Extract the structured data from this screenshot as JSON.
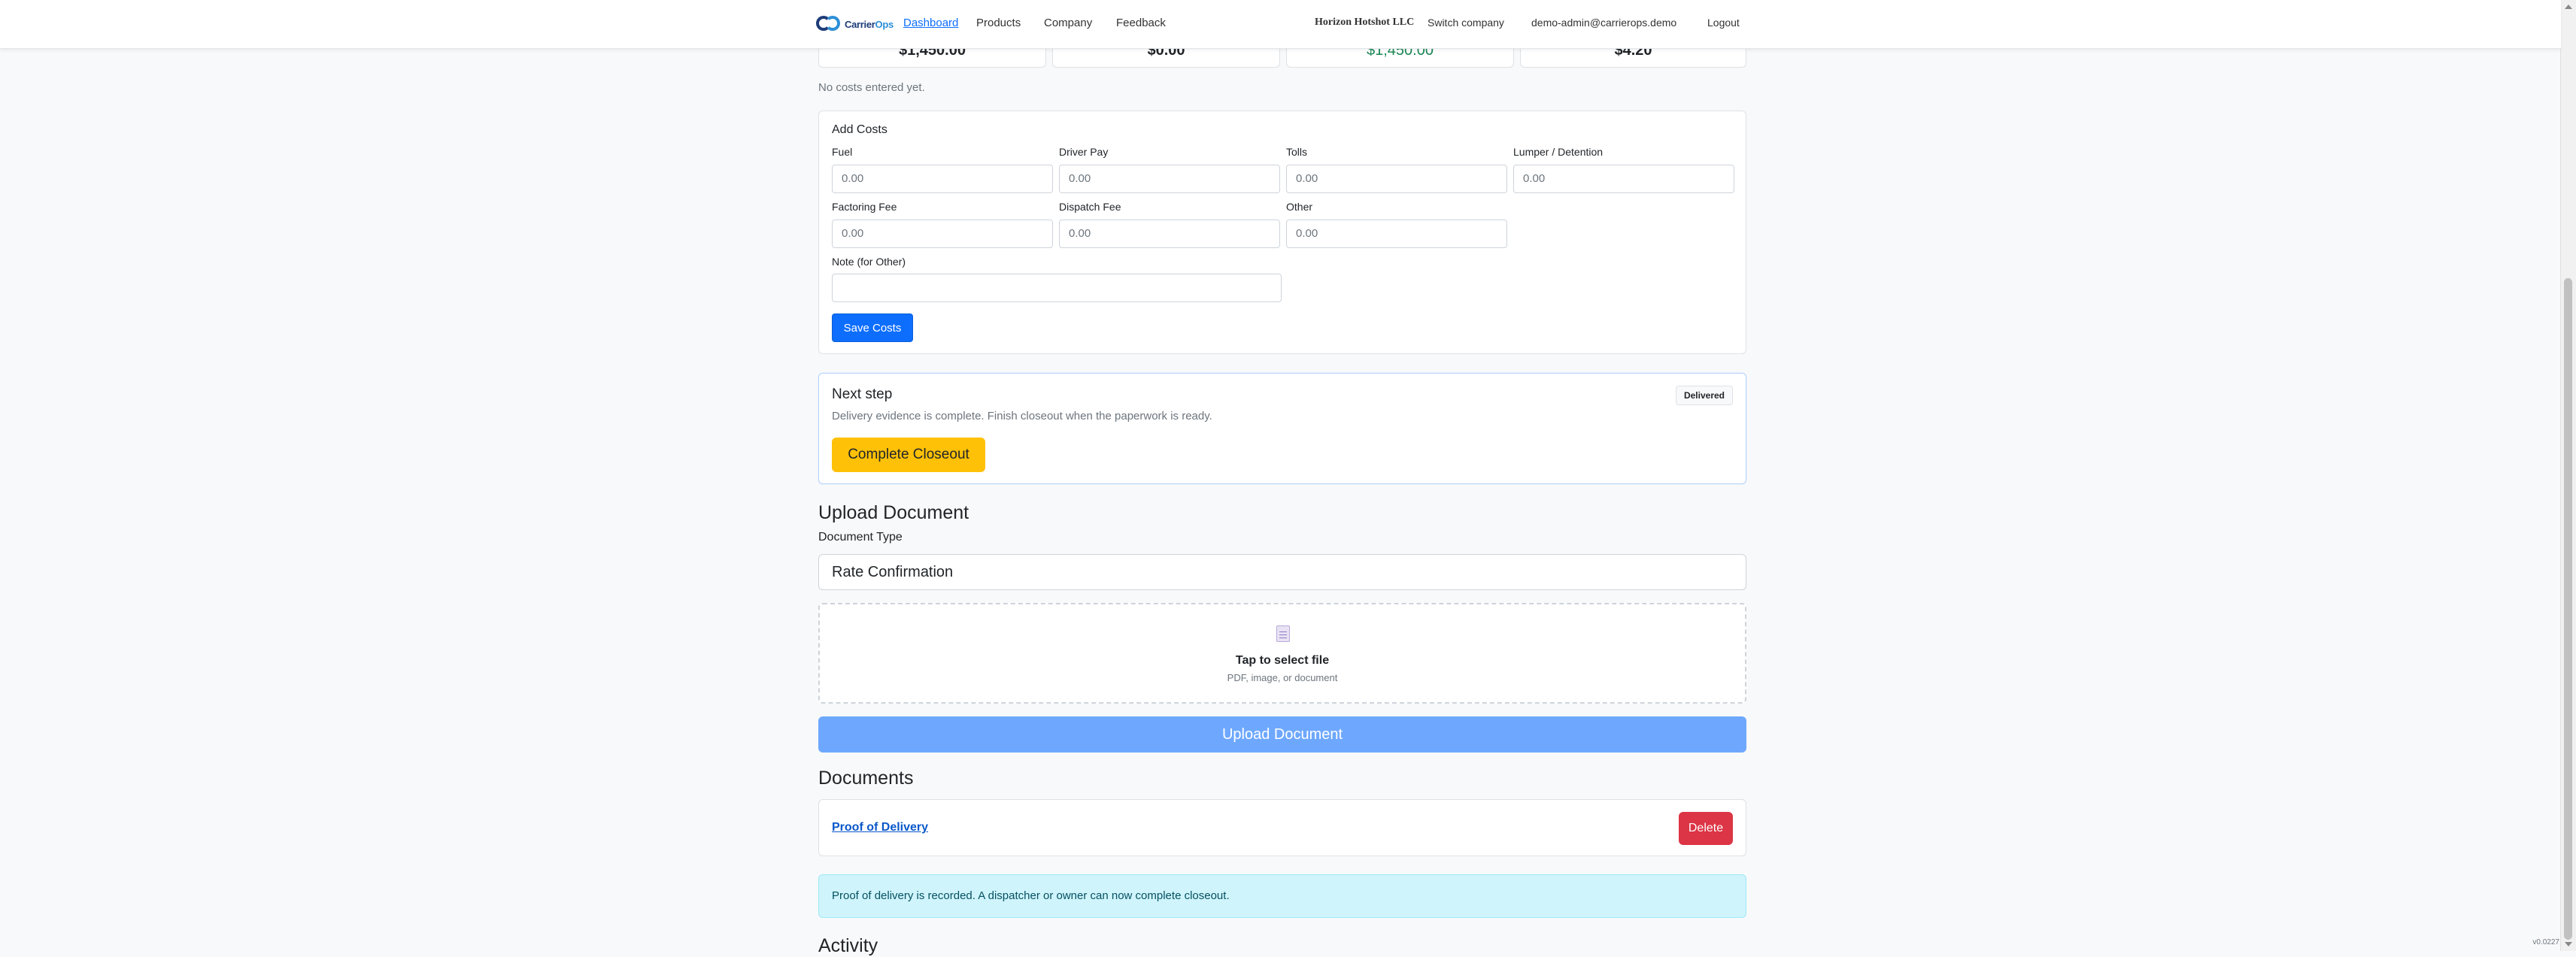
{
  "nav": {
    "brand_main": "Carrier",
    "brand_accent": "Ops",
    "links": [
      "Dashboard",
      "Products",
      "Company",
      "Feedback"
    ],
    "company": "Horizon Hotshot LLC",
    "switch_company": "Switch company",
    "user_email": "demo-admin@carrierops.demo",
    "logout": "Logout"
  },
  "summary": {
    "values": [
      "$1,450.00",
      "$0.00",
      "$1,450.00",
      "$4.20"
    ]
  },
  "costs": {
    "empty_text": "No costs entered yet.",
    "title": "Add Costs",
    "fields": [
      {
        "label": "Fuel",
        "placeholder": "0.00"
      },
      {
        "label": "Driver Pay",
        "placeholder": "0.00"
      },
      {
        "label": "Tolls",
        "placeholder": "0.00"
      },
      {
        "label": "Lumper / Detention",
        "placeholder": "0.00"
      },
      {
        "label": "Factoring Fee",
        "placeholder": "0.00"
      },
      {
        "label": "Dispatch Fee",
        "placeholder": "0.00"
      },
      {
        "label": "Other",
        "placeholder": "0.00"
      }
    ],
    "note_label": "Note (for Other)",
    "note_value": "",
    "save_label": "Save Costs"
  },
  "next_step": {
    "title": "Next step",
    "description": "Delivery evidence is complete. Finish closeout when the paperwork is ready.",
    "badge": "Delivered",
    "button": "Complete Closeout"
  },
  "upload": {
    "heading": "Upload Document",
    "type_label": "Document Type",
    "type_value": "Rate Confirmation",
    "drop_title": "Tap to select file",
    "drop_sub": "PDF, image, or document",
    "button": "Upload Document"
  },
  "documents": {
    "heading": "Documents",
    "items": [
      {
        "name": "Proof of Delivery",
        "delete_label": "Delete"
      }
    ]
  },
  "alert": "Proof of delivery is recorded. A dispatcher or owner can now complete closeout.",
  "activity_heading": "Activity",
  "version": "v0.0227",
  "colors": {
    "primary": "#0d6efd",
    "warning": "#ffc107",
    "danger": "#dc3545",
    "success": "#198754",
    "info_bg": "#cff4fc"
  }
}
